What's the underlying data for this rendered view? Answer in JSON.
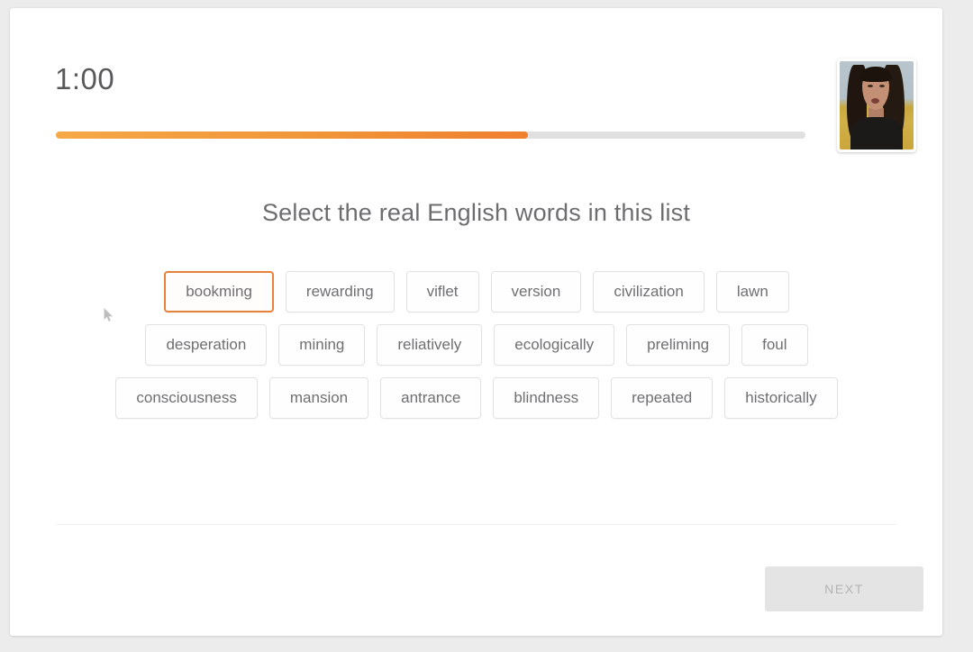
{
  "header": {
    "timer": "1:00",
    "progress_percent": 63,
    "webcam_label": "webcam-video-thumbnail"
  },
  "prompt": {
    "text": "Select the real English words in this list"
  },
  "word_rows": [
    [
      {
        "label": "bookming",
        "selected": true
      },
      {
        "label": "rewarding",
        "selected": false
      },
      {
        "label": "viflet",
        "selected": false
      },
      {
        "label": "version",
        "selected": false
      },
      {
        "label": "civilization",
        "selected": false
      },
      {
        "label": "lawn",
        "selected": false
      }
    ],
    [
      {
        "label": "desperation",
        "selected": false
      },
      {
        "label": "mining",
        "selected": false
      },
      {
        "label": "reliatively",
        "selected": false
      },
      {
        "label": "ecologically",
        "selected": false
      },
      {
        "label": "preliming",
        "selected": false
      },
      {
        "label": "foul",
        "selected": false
      }
    ],
    [
      {
        "label": "consciousness",
        "selected": false
      },
      {
        "label": "mansion",
        "selected": false
      },
      {
        "label": "antrance",
        "selected": false
      },
      {
        "label": "blindness",
        "selected": false
      },
      {
        "label": "repeated",
        "selected": false
      },
      {
        "label": "historically",
        "selected": false
      }
    ]
  ],
  "footer": {
    "next_label": "NEXT",
    "next_disabled": true
  },
  "colors": {
    "accent": "#ef8a34",
    "selected_border": "#e8823a",
    "chip_border": "#e2e2e2",
    "text": "#6f6f71",
    "page_background": "#ececec",
    "card_background": "#ffffff",
    "next_background": "#e4e4e4",
    "next_text": "#b4b4b4"
  }
}
